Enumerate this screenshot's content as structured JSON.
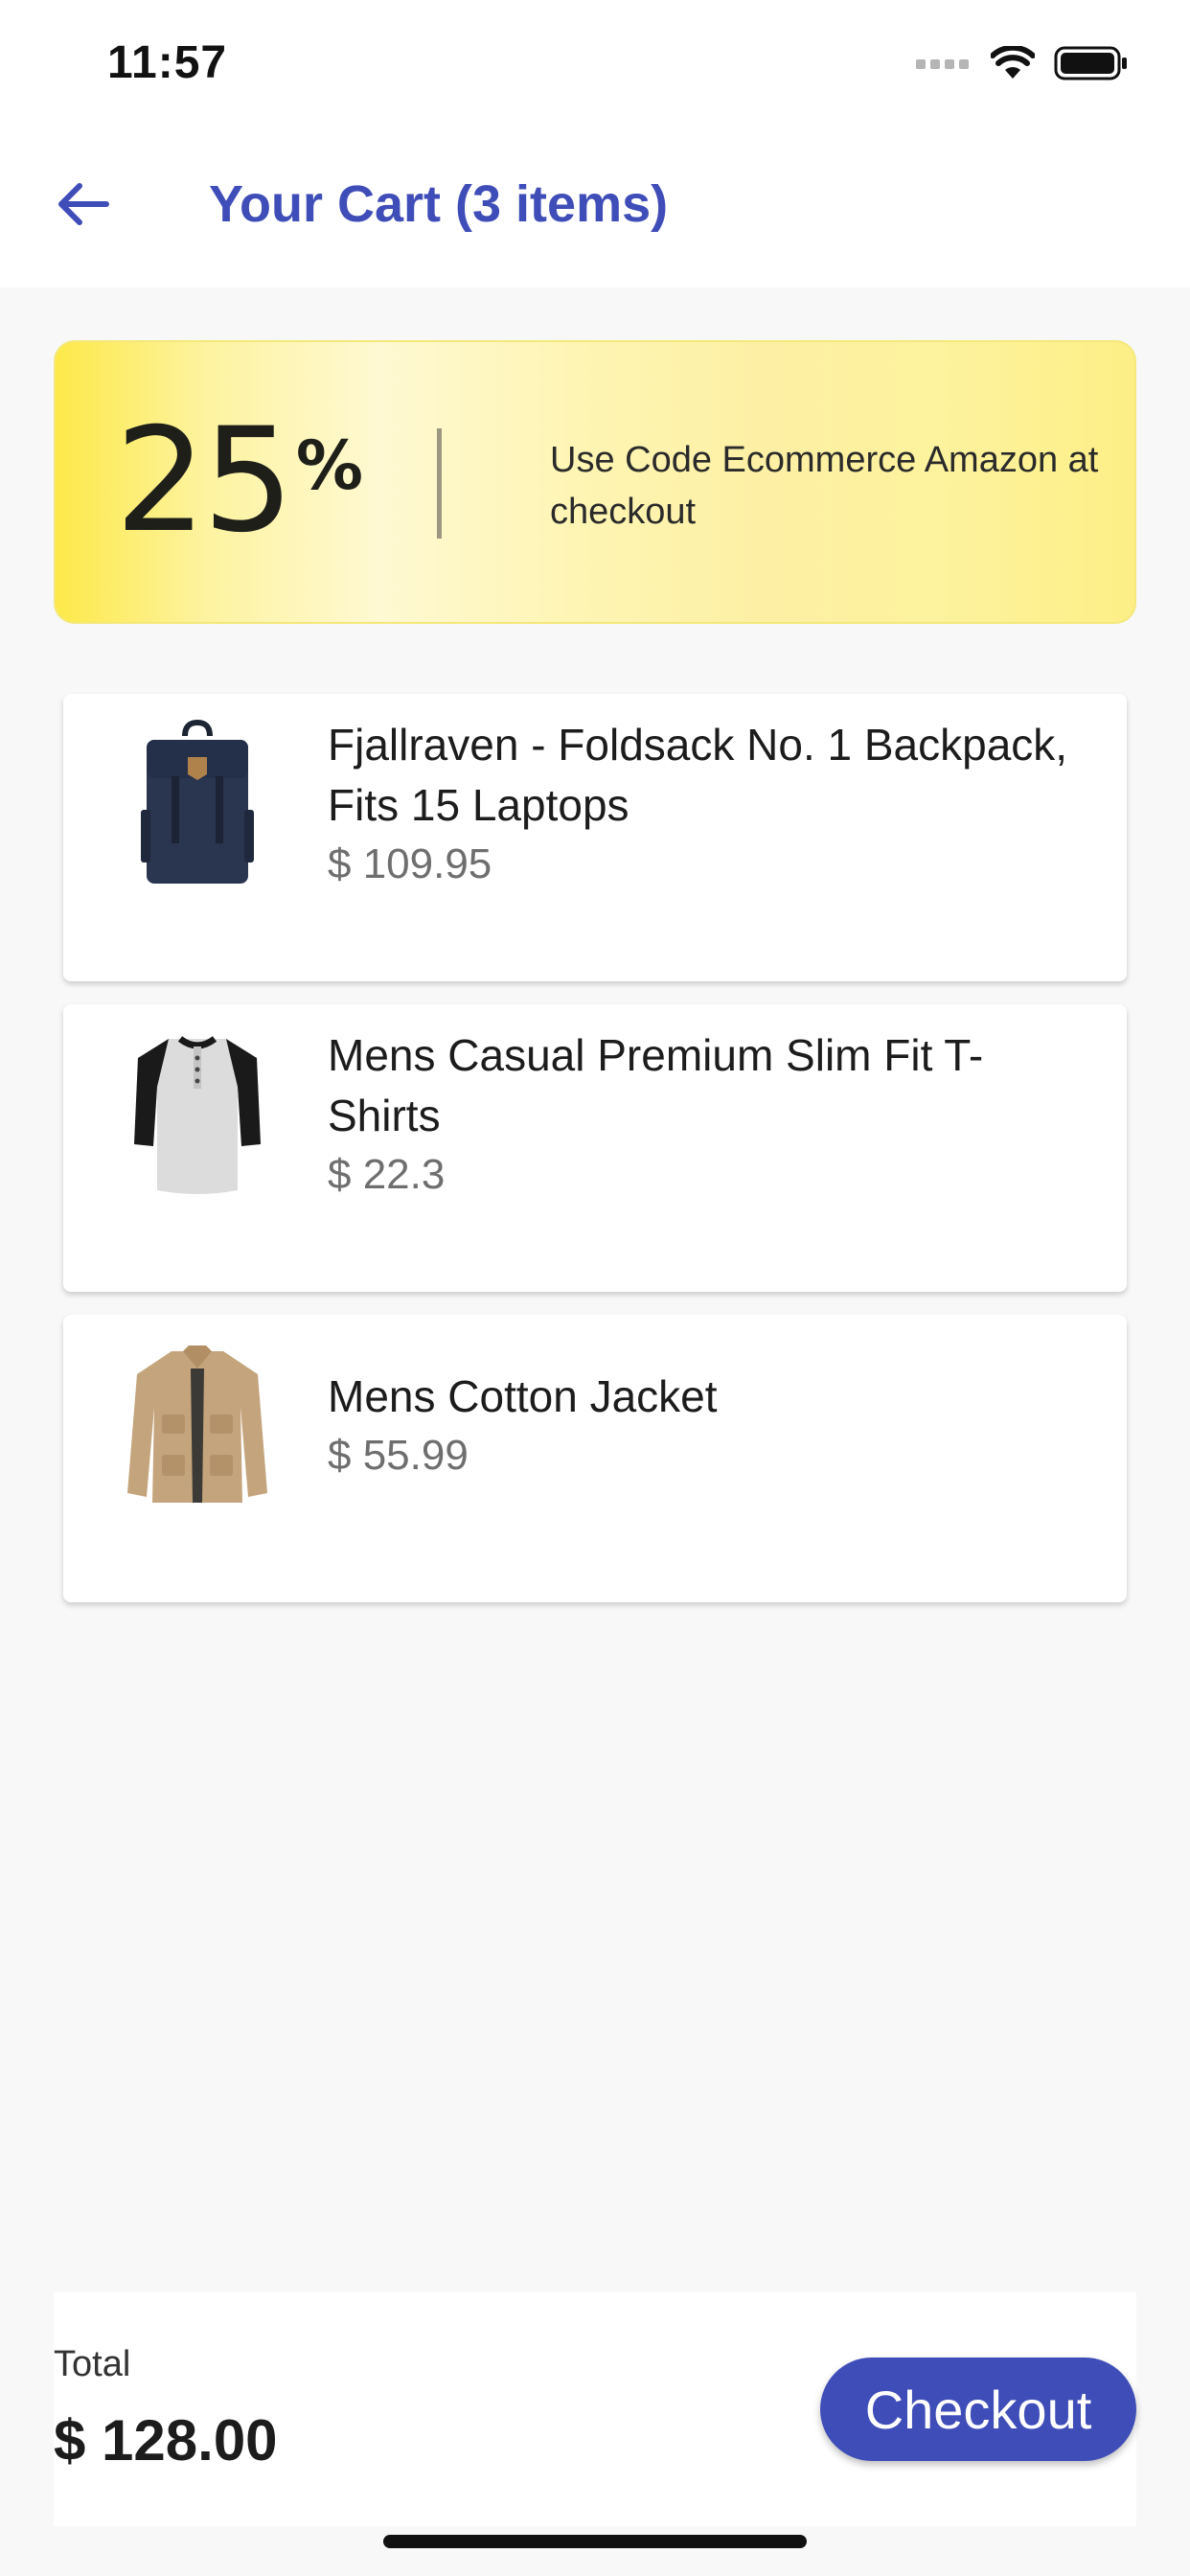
{
  "status_bar": {
    "time": "11:57",
    "icons": [
      "signal-icon",
      "wifi-icon",
      "battery-icon"
    ]
  },
  "header": {
    "back_icon": "arrow-left-icon",
    "title": "Your Cart (3 items)"
  },
  "promo": {
    "percent": "25",
    "percent_sign": "%",
    "text": "Use Code Ecommerce Amazon at checkout"
  },
  "cart": {
    "items": [
      {
        "name": "Fjallraven - Foldsack No. 1 Backpack, Fits 15 Laptops",
        "price": "$ 109.95",
        "image_icon": "backpack-image"
      },
      {
        "name": "Mens Casual Premium Slim Fit T-Shirts",
        "price": "$ 22.3",
        "image_icon": "tshirt-image"
      },
      {
        "name": "Mens Cotton Jacket",
        "price": "$ 55.99",
        "image_icon": "jacket-image"
      }
    ]
  },
  "footer": {
    "total_label": "Total",
    "total_value": "$ 128.00",
    "checkout_label": "Checkout"
  },
  "colors": {
    "accent": "#3f4db8",
    "promo_yellow": "#fde94a",
    "background": "#f8f8f8"
  }
}
